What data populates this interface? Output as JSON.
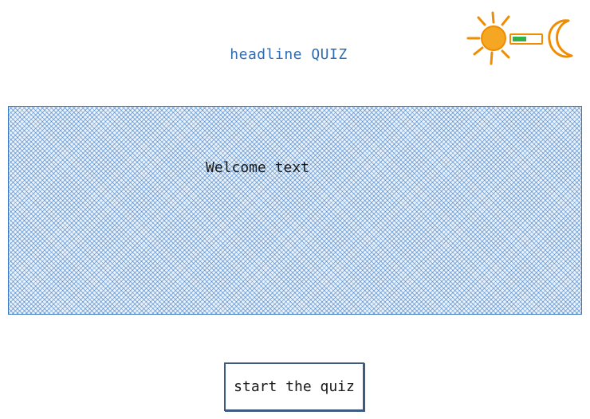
{
  "header": {
    "title": "headline QUIZ"
  },
  "theme_toggle": {
    "light_icon": "sun-icon",
    "dark_icon": "moon-icon",
    "state": "light",
    "colors": {
      "sun": "#f5a623",
      "sun_rays": "#f08c00",
      "moon": "#f08c00",
      "switch_on": "#2fb24a"
    }
  },
  "welcome": {
    "text": "Welcome text",
    "fill_color": "#3a78c0"
  },
  "actions": {
    "start_label": "start the quiz"
  }
}
